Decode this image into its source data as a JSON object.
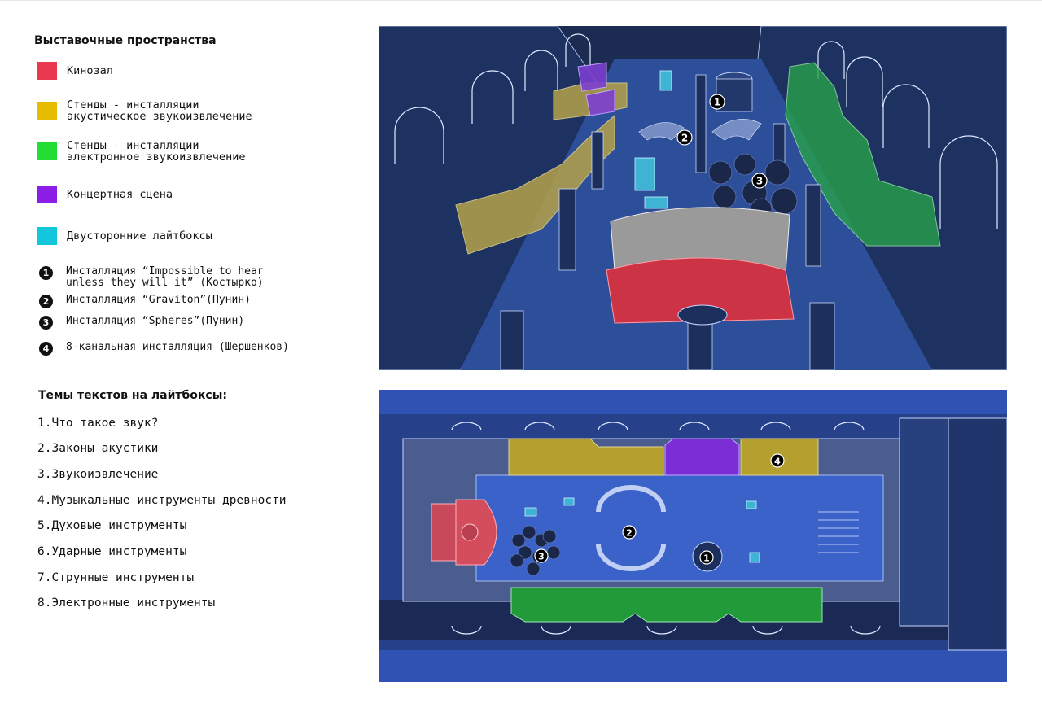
{
  "legend": {
    "title": "Выставочные пространства",
    "items": [
      {
        "label": "Кинозал",
        "color": "#e8394f"
      },
      {
        "label": "Стенды - инсталляции\nакустическое звукоизвлечение",
        "color": "#e5bd00"
      },
      {
        "label": "Стенды - инсталляции\nэлектронное звукоизвлечение",
        "color": "#22dd33"
      },
      {
        "label": "Концертная сцена",
        "color": "#8a1ee6"
      },
      {
        "label": "Двусторонние лайтбоксы",
        "color": "#11c6dd"
      }
    ]
  },
  "installations": [
    {
      "number": "1",
      "label": "Инсталляция “Impossible to hear\nunless they will it” (Костырко)"
    },
    {
      "number": "2",
      "label": "Инсталляция “Graviton”(Пунин)"
    },
    {
      "number": "3",
      "label": "Инсталляция “Spheres”(Пунин)"
    },
    {
      "number": "4",
      "label": "8-канальная инсталляция (Шершенков)"
    }
  ],
  "topics": {
    "title": "Темы текстов на лайтбоксы:",
    "items": [
      "1.Что такое звук?",
      "2.Законы акустики",
      "3.Звукоизвлечение",
      "4.Музыкальные инструменты древности",
      "5.Духовые инструменты",
      "6.Ударные инструменты",
      "7.Струнные инструменты",
      "8.Электронные инструменты"
    ]
  },
  "perspective_view": {
    "markers": [
      {
        "number": "1"
      },
      {
        "number": "2"
      },
      {
        "number": "3"
      }
    ]
  },
  "plan_view": {
    "markers": [
      {
        "number": "1"
      },
      {
        "number": "2"
      },
      {
        "number": "3"
      },
      {
        "number": "4"
      }
    ]
  }
}
